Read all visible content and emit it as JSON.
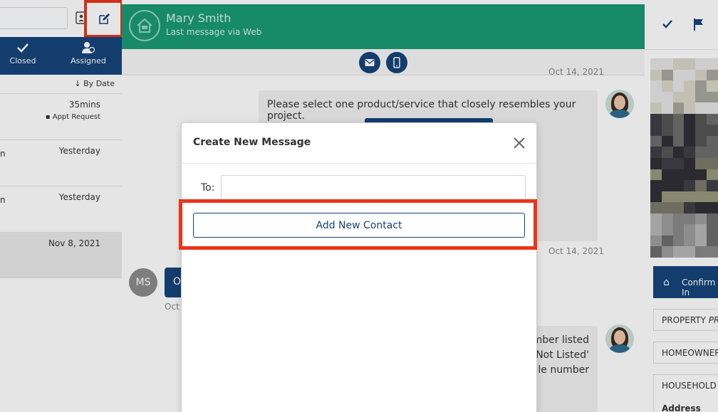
{
  "left_panel": {
    "filter_tabs": [
      {
        "label": "Closed",
        "icon": "check-icon"
      },
      {
        "label": "Assigned",
        "icon": "assigned-user-icon"
      }
    ],
    "sort_label": "By Date",
    "conversations": [
      {
        "time": "35mins",
        "tag": "Appt Request",
        "edge_text": ""
      },
      {
        "time": "Yesterday",
        "tag": "",
        "edge_text": "n"
      },
      {
        "time": "Yesterday",
        "tag": "",
        "edge_text": "n"
      },
      {
        "time": "Nov 8, 2021",
        "tag": "",
        "edge_text": ""
      }
    ]
  },
  "chat": {
    "contact_name": "Mary Smith",
    "contact_sub": "Last message via Web",
    "stamp_top": "Oct 14, 2021",
    "message_1": "Please select one product/service that closely resembles your project.",
    "stamp_mid": "Oct 14, 2021",
    "ms_initials": "MS",
    "in_bubble_partial": "O",
    "stamp_in_partial": "Oct",
    "message_2_lines": [
      "mber listed",
      "'Not Listed'",
      "bile number"
    ]
  },
  "right_panel": {
    "confirm_label": "Confirm In",
    "property_label": "PROPERTY",
    "property_italic": "PRE",
    "homeowner_label": "HOMEOWNER",
    "household_label": "HOUSEHOLD",
    "address_label": "Address"
  },
  "modal": {
    "title": "Create New Message",
    "to_label": "To:",
    "to_value": "",
    "add_contact_label": "Add New Contact"
  },
  "colors": {
    "brand_navy": "#16447a",
    "header_green": "#1a9a74",
    "highlight_red": "#e8351c"
  }
}
